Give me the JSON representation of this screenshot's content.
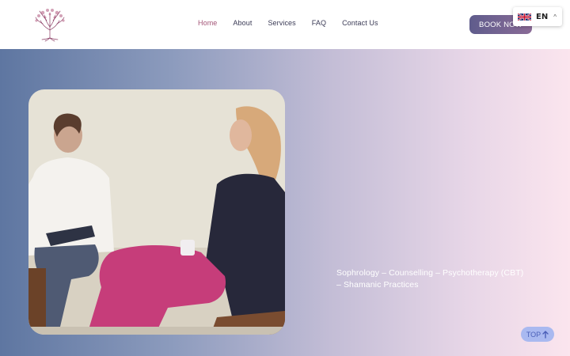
{
  "nav": {
    "items": [
      {
        "label": "Home",
        "active": true
      },
      {
        "label": "About"
      },
      {
        "label": "Services"
      },
      {
        "label": "FAQ"
      },
      {
        "label": "Contact Us"
      }
    ]
  },
  "header": {
    "book_label": "BOOK NOW",
    "language_code": "EN"
  },
  "hero": {
    "tagline": "Sophrology – Counselling – Psychotherapy (CBT) – Shamanic Practices",
    "photo": "counselling-session-photo"
  },
  "scroll_top": {
    "label": "TOP"
  },
  "colors": {
    "accent": "#a35577",
    "book_button": "#6f6390",
    "top_button": "#a9b9f0",
    "hero_left": "#5e76a1",
    "hero_right": "#fbe5ee"
  }
}
